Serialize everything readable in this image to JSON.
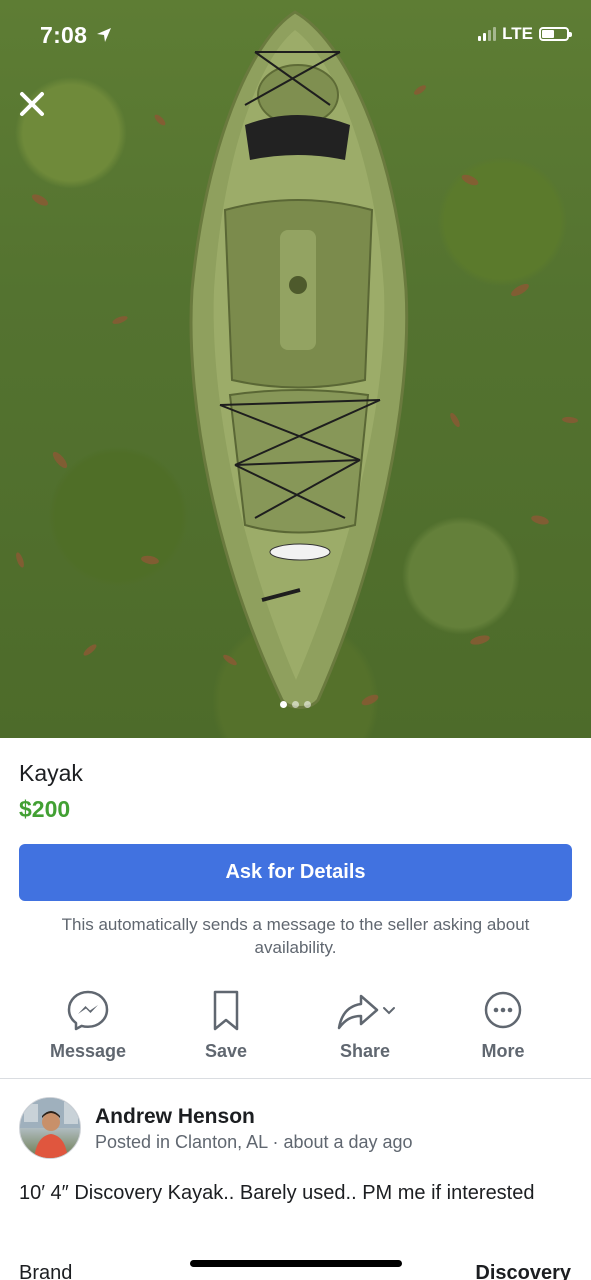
{
  "status_bar": {
    "time": "7:08",
    "network": "LTE",
    "icons": [
      "location-arrow-icon",
      "signal-icon",
      "battery-icon"
    ]
  },
  "photo": {
    "subject_icon": "kayak-photo",
    "carousel_total": 3,
    "carousel_active": 1
  },
  "listing": {
    "title": "Kayak",
    "price": "$200",
    "price_color": "#42a033"
  },
  "ask": {
    "button_label": "Ask for Details",
    "button_color": "#4172e0",
    "note": "This automatically sends a message to the seller asking about availability."
  },
  "actions": [
    {
      "label": "Message",
      "icon": "messenger-icon"
    },
    {
      "label": "Save",
      "icon": "bookmark-icon"
    },
    {
      "label": "Share",
      "icon": "share-arrow-icon"
    },
    {
      "label": "More",
      "icon": "more-dots-icon"
    }
  ],
  "seller": {
    "name": "Andrew Henson",
    "meta": "Posted in Clanton, AL · about a day ago"
  },
  "description": "10′ 4″ Discovery Kayak.. Barely used.. PM me if interested",
  "attributes": [
    {
      "label": "Brand",
      "value": "Discovery"
    }
  ]
}
